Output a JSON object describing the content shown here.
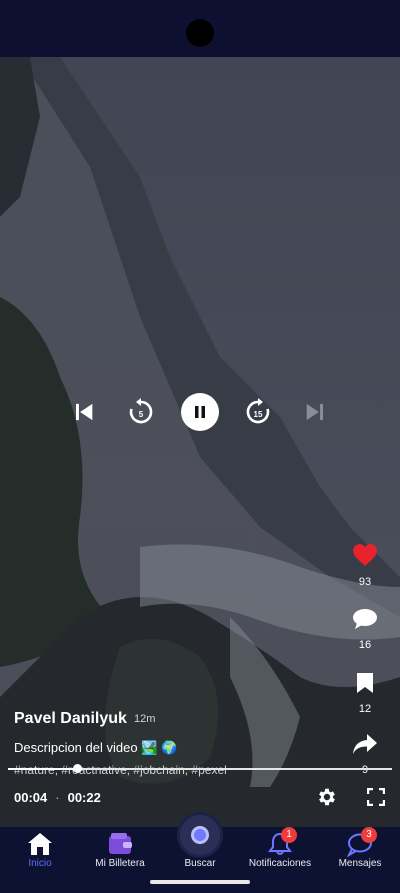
{
  "video": {
    "author": "Pavel Danilyuk",
    "time_ago": "12m",
    "description": "Descripcion del video 🏞️ 🌍",
    "tags": "#nature, #reactnative, #jobchain, #pexel",
    "current_time": "00:04",
    "separator": "·",
    "duration": "00:22",
    "progress_fraction": 0.18,
    "rewind_seconds": "5",
    "forward_seconds": "15"
  },
  "actions": {
    "likes": "93",
    "comments": "16",
    "saves": "12",
    "shares": "9"
  },
  "colors": {
    "accent": "#5a6cff",
    "like": "#e8232d",
    "badge": "#ef3b3b"
  },
  "nav": {
    "items": [
      {
        "label": "Inicio",
        "icon": "home-icon"
      },
      {
        "label": "Mi Billetera",
        "icon": "wallet-icon"
      },
      {
        "label": "Buscar",
        "icon": "search-icon"
      },
      {
        "label": "Notificaciones",
        "icon": "bell-icon",
        "badge": "1"
      },
      {
        "label": "Mensajes",
        "icon": "chat-icon",
        "badge": "3"
      }
    ]
  }
}
